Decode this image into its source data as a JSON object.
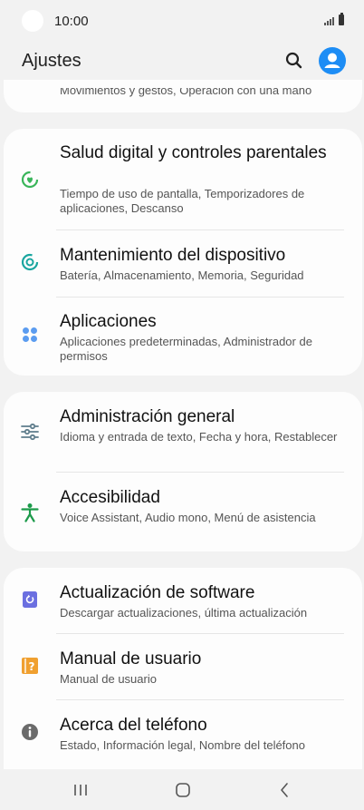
{
  "status": {
    "time": "10:00"
  },
  "header": {
    "title": "Ajustes"
  },
  "partial_item": {
    "subtitle": "Movimientos y gestos, Operación con una mano"
  },
  "groups": [
    {
      "items": [
        {
          "title": "Salud digital y controles parentales",
          "subtitle": "Tiempo de uso de pantalla, Temporizadores de aplicaciones, Descanso",
          "icon": "digital-wellbeing-icon"
        },
        {
          "title": "Mantenimiento del dispositivo",
          "subtitle": "Batería, Almacenamiento, Memoria, Seguridad",
          "icon": "device-care-icon"
        },
        {
          "title": "Aplicaciones",
          "subtitle": "Aplicaciones predeterminadas, Administrador de permisos",
          "icon": "apps-icon"
        }
      ]
    },
    {
      "items": [
        {
          "title": "Administración general",
          "subtitle": "Idioma y entrada de texto, Fecha y hora, Restablecer",
          "icon": "general-management-icon"
        },
        {
          "title": "Accesibilidad",
          "subtitle": "Voice Assistant, Audio mono, Menú de asistencia",
          "icon": "accessibility-icon"
        }
      ]
    },
    {
      "items": [
        {
          "title": "Actualización de software",
          "subtitle": "Descargar actualizaciones, última actualización",
          "icon": "software-update-icon"
        },
        {
          "title": "Manual de usuario",
          "subtitle": "Manual de usuario",
          "icon": "user-manual-icon"
        },
        {
          "title": "Acerca del teléfono",
          "subtitle": "Estado, Información legal, Nombre del teléfono",
          "icon": "about-phone-icon"
        }
      ]
    }
  ],
  "colors": {
    "background": "#f2f2f2",
    "card": "#fdfdfd",
    "accent_blue": "#1d8df5",
    "wellbeing_green": "#3ab55a",
    "device_care_teal": "#1aa6a0",
    "apps_blue": "#5b9cf0",
    "general_gray": "#5f7d8c",
    "accessibility_green": "#1c9a4a",
    "update_purple": "#6b6fe0",
    "manual_orange": "#f0a030",
    "about_gray": "#6b6b6b"
  }
}
